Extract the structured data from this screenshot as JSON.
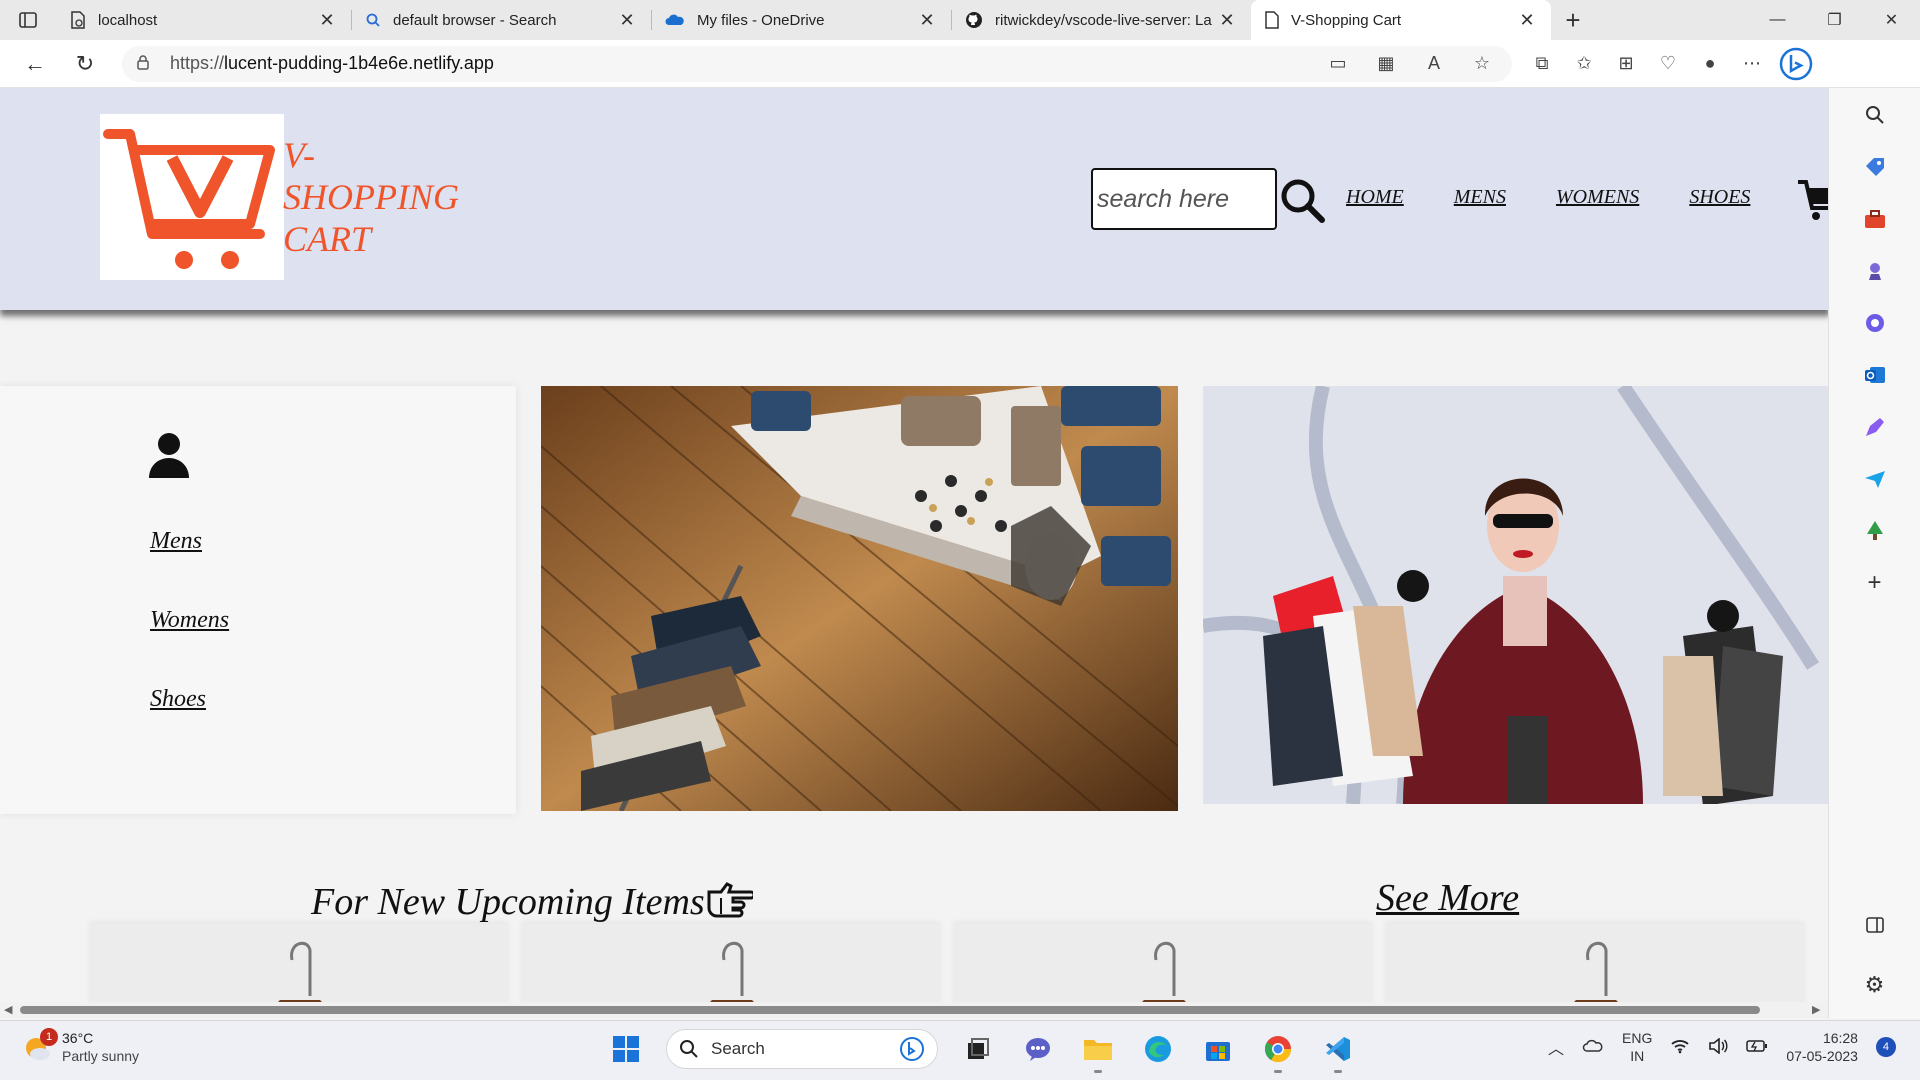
{
  "browser": {
    "tabs": [
      {
        "title": "localhost",
        "icon": "page-icon"
      },
      {
        "title": "default browser - Search",
        "icon": "search-icon"
      },
      {
        "title": "My files - OneDrive",
        "icon": "onedrive-icon"
      },
      {
        "title": "ritwickdey/vscode-live-server: La",
        "icon": "github-icon"
      },
      {
        "title": "V-Shopping Cart",
        "icon": "page-icon"
      }
    ],
    "url_prefix": "https://",
    "url_host": "lucent-pudding-1b4e6e.netlify.app"
  },
  "site": {
    "brand_line1": "V-",
    "brand_line2": "SHOPPING",
    "brand_line3": "CART",
    "search_placeholder": "search here",
    "nav": [
      "HOME",
      "MENS",
      "WOMENS",
      "SHOES"
    ],
    "side_links": [
      "Mens",
      "Womens",
      "Shoes"
    ],
    "upcoming_title": "For New Upcoming Items",
    "see_more": "See More",
    "accent_color": "#f0542a",
    "header_bg": "#dde1f0"
  },
  "taskbar": {
    "weather_temp": "36°C",
    "weather_cond": "Partly sunny",
    "weather_badge": "1",
    "search_label": "Search",
    "lang_line1": "ENG",
    "lang_line2": "IN",
    "time": "16:28",
    "date": "07-05-2023",
    "notification_count": "4"
  }
}
